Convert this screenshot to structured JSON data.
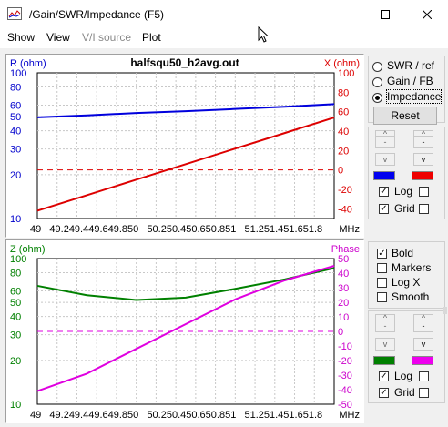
{
  "window": {
    "title": "/Gain/SWR/Impedance (F5)"
  },
  "menu": {
    "show": "Show",
    "view": "View",
    "vi_source": "V/I source",
    "plot": "Plot"
  },
  "colors": {
    "r_series": "#0000dd",
    "x_series": "#dd0000",
    "z_series": "#008000",
    "phase_series": "#e000e0",
    "r_axis_text": "#0000cc",
    "x_axis_text": "#dd0000",
    "z_axis_text": "#008000",
    "phase_axis_text": "#cc00cc"
  },
  "top_plot": {
    "title": "halfsqu50_h2avg.out",
    "left_unit": "R (ohm)",
    "right_unit": "X (ohm)",
    "left_ticks": [
      "100",
      "80",
      "60",
      "50",
      "40",
      "30",
      "20",
      "10"
    ],
    "right_ticks": [
      "100",
      "80",
      "60",
      "40",
      "20",
      "0",
      "-20",
      "-40"
    ],
    "x_tick_text": "49   49.249.449.649.850   50.250.450.650.851   51.251.451.651.8",
    "x_unit": "MHz"
  },
  "bottom_plot": {
    "left_unit": "Z (ohm)",
    "right_unit": "Phase",
    "left_ticks": [
      "100",
      "80",
      "60",
      "50",
      "40",
      "30",
      "20",
      "10"
    ],
    "right_ticks": [
      "50",
      "40",
      "30",
      "20",
      "10",
      "0",
      "-10",
      "-20",
      "-30",
      "-40",
      "-50"
    ],
    "x_tick_text": "49   49.249.449.649.850   50.250.450.650.851   51.251.451.651.8",
    "x_unit": "MHz"
  },
  "chart_data": [
    {
      "type": "line",
      "title": "halfsqu50_h2avg.out",
      "xlabel": "MHz",
      "ylabel": "R (ohm)",
      "y2label": "X (ohm)",
      "xlim": [
        49,
        52
      ],
      "ylim": [
        10,
        100
      ],
      "y_scale": "log",
      "y2lim": [
        -50,
        100
      ],
      "grid": true,
      "series": [
        {
          "name": "R (ohm)",
          "axis": "left",
          "color": "#0000dd",
          "x": [
            49,
            49.5,
            50,
            50.5,
            51,
            51.5,
            52
          ],
          "y": [
            49.5,
            51,
            53,
            54.5,
            56.5,
            58.5,
            61
          ]
        },
        {
          "name": "X (ohm)",
          "axis": "right",
          "color": "#dd0000",
          "x": [
            49,
            49.5,
            50,
            50.5,
            51,
            51.5,
            52
          ],
          "y": [
            -42,
            -26,
            -10,
            6,
            22,
            38,
            54
          ]
        }
      ],
      "reference_line": {
        "axis": "right",
        "y": 0,
        "style": "dashed",
        "color": "#dd0000"
      }
    },
    {
      "type": "line",
      "xlabel": "MHz",
      "ylabel": "Z (ohm)",
      "y2label": "Phase",
      "xlim": [
        49,
        52
      ],
      "ylim": [
        10,
        100
      ],
      "y_scale": "log",
      "y2lim": [
        -50,
        50
      ],
      "grid": true,
      "series": [
        {
          "name": "Z (ohm)",
          "axis": "left",
          "color": "#008000",
          "x": [
            49,
            49.5,
            50,
            50.5,
            51,
            51.5,
            52
          ],
          "y": [
            65,
            56,
            52,
            54,
            62,
            72,
            86
          ]
        },
        {
          "name": "Phase",
          "axis": "right",
          "color": "#e000e0",
          "x": [
            49,
            49.5,
            50,
            50.5,
            51,
            51.5,
            52
          ],
          "y": [
            -41,
            -29,
            -12,
            5,
            22,
            35,
            45
          ]
        }
      ],
      "reference_line": {
        "axis": "right",
        "y": 0,
        "style": "dashed",
        "color": "#e000e0"
      }
    }
  ],
  "controls_top": {
    "radio_swr": "SWR / ref",
    "radio_gain": "Gain / FB",
    "radio_impedance": "Impedance",
    "reset_label": "Reset",
    "up_glyph": "^",
    "minus_glyph": "-",
    "down_glyph": "v",
    "left_color": "#0000ee",
    "right_color": "#ee0000",
    "log_label": "Log",
    "grid_label": "Grid",
    "log_left_checked": true,
    "grid_left_checked": true
  },
  "controls_bottom": {
    "bold_label": "Bold",
    "markers_label": "Markers",
    "logx_label": "Log X",
    "smooth_label": "Smooth",
    "up_glyph": "^",
    "minus_glyph": "-",
    "down_glyph": "v",
    "left_color": "#008000",
    "right_color": "#ee00ee",
    "log_label": "Log",
    "grid_label": "Grid",
    "bold_checked": true,
    "log_left_checked": true,
    "grid_left_checked": true
  }
}
